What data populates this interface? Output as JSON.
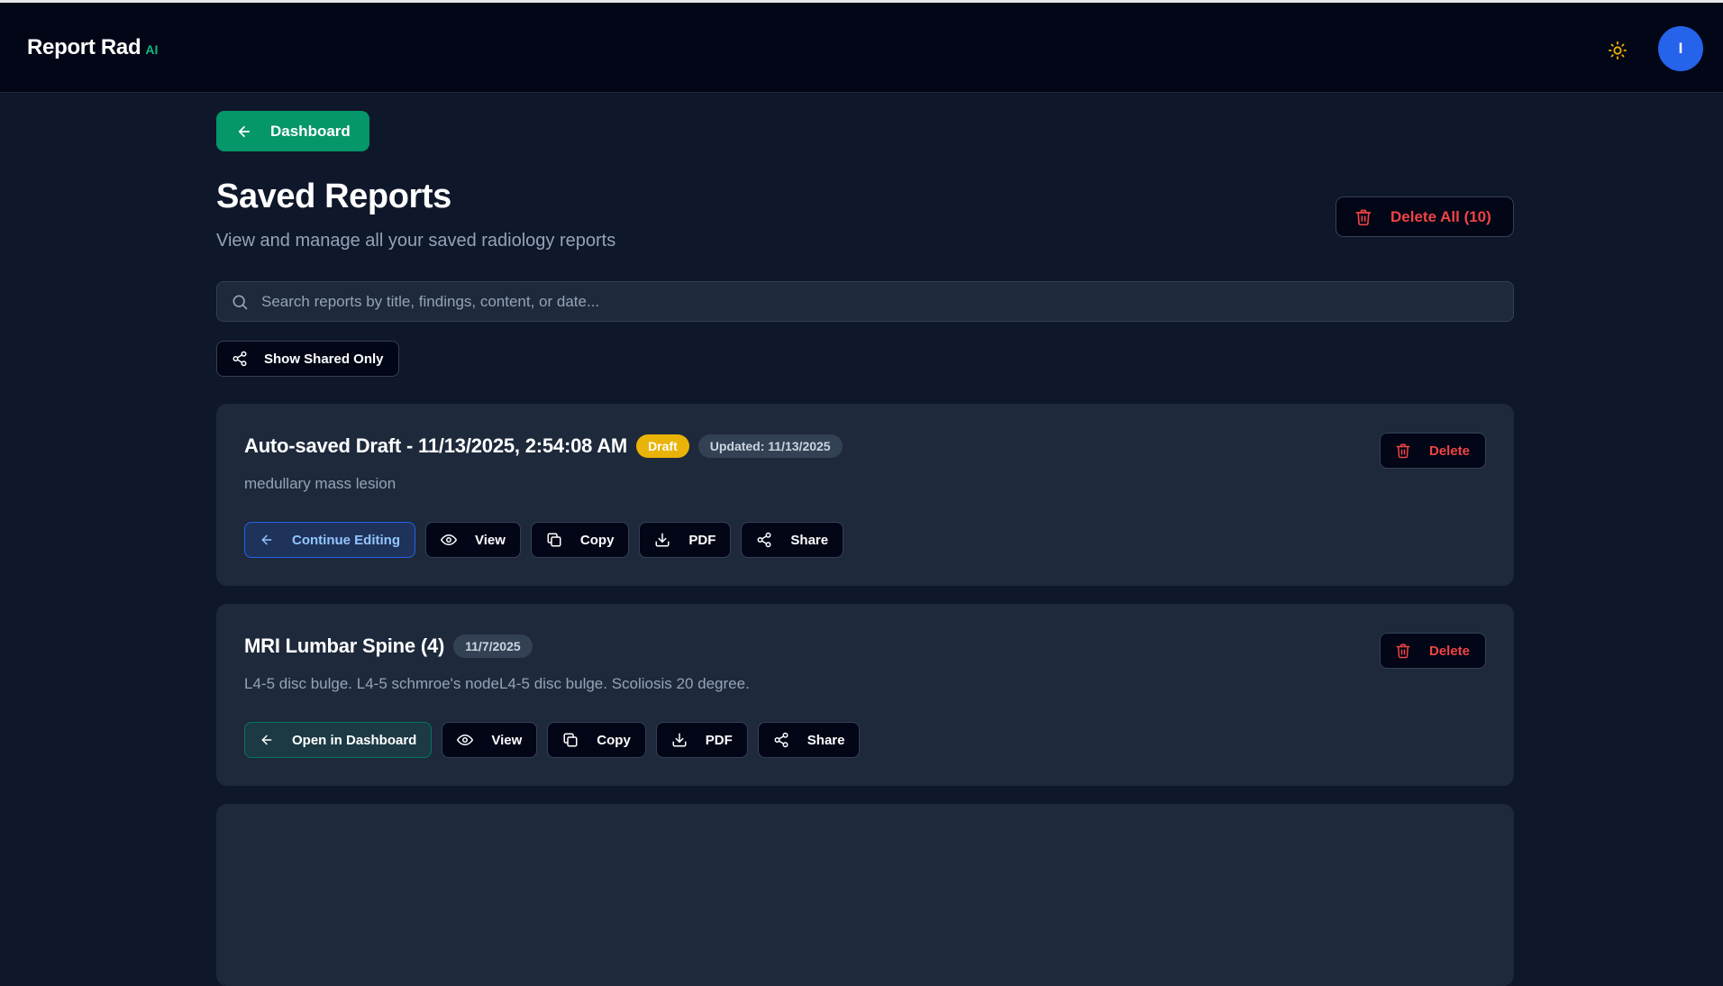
{
  "header": {
    "brand_name": "Report Rad",
    "brand_badge": "AI",
    "avatar_initial": "I"
  },
  "nav": {
    "back_label": "Dashboard"
  },
  "page": {
    "title": "Saved Reports",
    "subtitle": "View and manage all your saved radiology reports",
    "delete_all_label": "Delete All (10)"
  },
  "search": {
    "placeholder": "Search reports by title, findings, content, or date...",
    "value": ""
  },
  "filters": {
    "shared_only_label": "Show Shared Only"
  },
  "reports": [
    {
      "title": "Auto-saved Draft - 11/13/2025, 2:54:08 AM",
      "status_badge": "Draft",
      "date_badge": "Updated: 11/13/2025",
      "description": "medullary mass lesion",
      "primary_action": "Continue Editing",
      "view_label": "View",
      "copy_label": "Copy",
      "pdf_label": "PDF",
      "share_label": "Share",
      "delete_label": "Delete"
    },
    {
      "title": "MRI Lumbar Spine (4)",
      "date_badge": "11/7/2025",
      "description": "L4-5 disc bulge. L4-5 schmroe's nodeL4-5 disc bulge. Scoliosis 20 degree.",
      "primary_action": "Open in Dashboard",
      "view_label": "View",
      "copy_label": "Copy",
      "pdf_label": "PDF",
      "share_label": "Share",
      "delete_label": "Delete"
    }
  ],
  "colors": {
    "accent_green": "#059669",
    "danger_red": "#ef4444",
    "draft_yellow": "#eab308",
    "avatar_blue": "#2563eb",
    "sun_icon": "#eab308"
  }
}
